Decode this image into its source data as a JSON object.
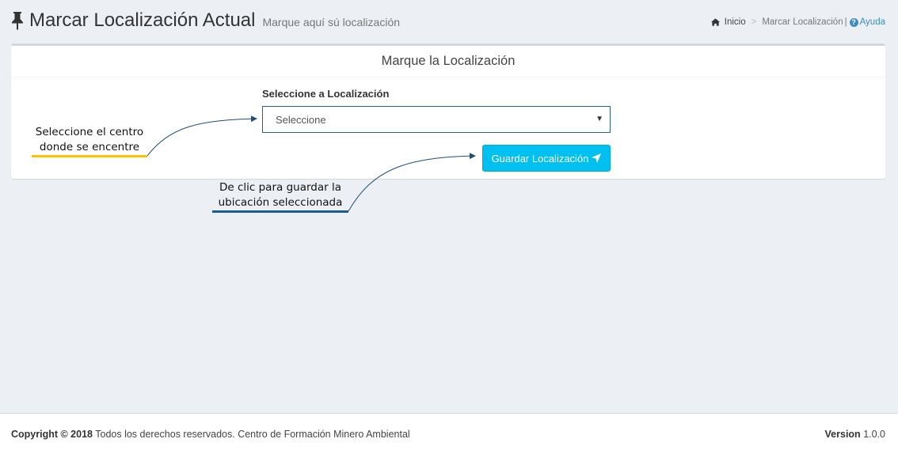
{
  "header": {
    "icon": "thumbtack-icon",
    "title": "Marcar Localización Actual",
    "subtitle": "Marque aquí sú localización"
  },
  "breadcrumb": {
    "home_label": "Inicio",
    "separator": ">",
    "current": "Marcar Localización",
    "divider": "|",
    "help_label": "Ayuda"
  },
  "box": {
    "title": "Marque la Localización",
    "field_label": "Seleccione a Localización",
    "select_value": "Seleccione",
    "save_label": "Guardar Localización"
  },
  "annotations": {
    "first": "Seleccione el centro donde se encentre",
    "second": "De clic para guardar la ubicación seleccionada"
  },
  "footer": {
    "copyright_label": "Copyright © 2018",
    "copyright_text": "Todos los derechos reservados. Centro de Formación Minero Ambiental",
    "version_label": "Version",
    "version_value": "1.0.0"
  },
  "colors": {
    "accent": "#00c0ef",
    "link": "#3c8dbc",
    "annotation_underline_1": "#ffc000",
    "annotation_underline_2": "#1f5b93"
  }
}
